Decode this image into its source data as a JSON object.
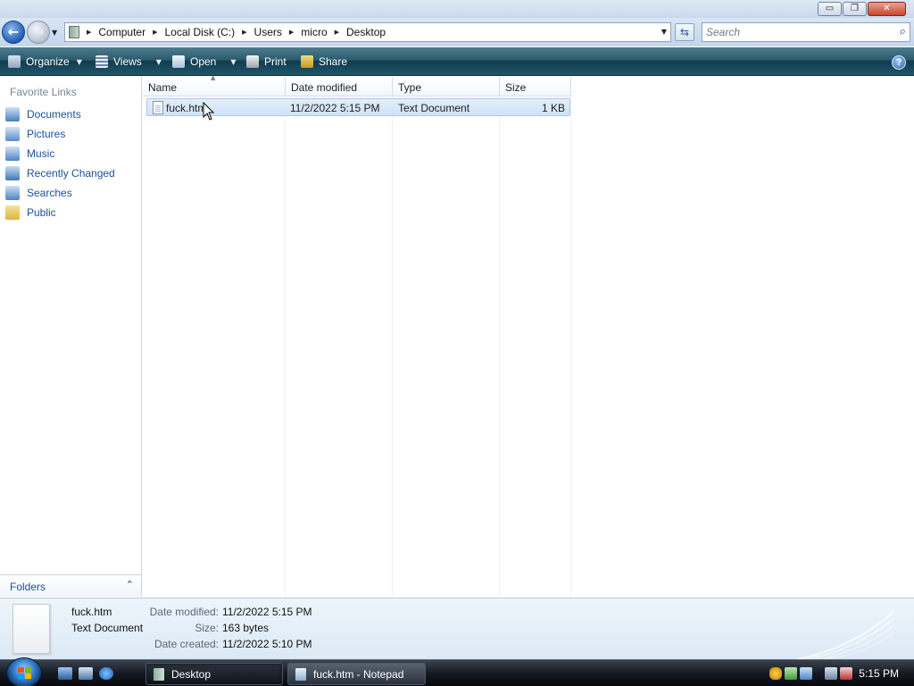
{
  "window": {
    "controls": {
      "minimize": "▭",
      "maximize": "❐",
      "close": "✕"
    }
  },
  "address_bar": {
    "back_glyph": "←",
    "forward_glyph": "→",
    "breadcrumbs": [
      "Computer",
      "Local Disk (C:)",
      "Users",
      "micro",
      "Desktop"
    ],
    "search_placeholder": "Search"
  },
  "command_bar": {
    "items": [
      {
        "label": "Organize",
        "icon": "organize-icon",
        "has_dropdown": true
      },
      {
        "label": "Views",
        "icon": "views-icon",
        "has_dropdown": true
      },
      {
        "label": "Open",
        "icon": "open-icon",
        "has_dropdown": true
      },
      {
        "label": "Print",
        "icon": "printer-icon",
        "has_dropdown": false
      },
      {
        "label": "Share",
        "icon": "share-icon",
        "has_dropdown": false
      }
    ],
    "help_glyph": "?"
  },
  "nav_pane": {
    "heading": "Favorite Links",
    "links": [
      {
        "label": "Documents",
        "icon": "documents-icon",
        "color": "#4a7fc1"
      },
      {
        "label": "Pictures",
        "icon": "pictures-icon",
        "color": "#5a8cc9"
      },
      {
        "label": "Music",
        "icon": "music-icon",
        "color": "#4f84c4"
      },
      {
        "label": "Recently Changed",
        "icon": "recently-changed-icon",
        "color": "#3f78b9"
      },
      {
        "label": "Searches",
        "icon": "searches-icon",
        "color": "#4d83c2"
      },
      {
        "label": "Public",
        "icon": "public-folder-icon",
        "color": "#e0b43a"
      }
    ],
    "folders_label": "Folders"
  },
  "file_list": {
    "columns": [
      "Name",
      "Date modified",
      "Type",
      "Size"
    ],
    "rows": [
      {
        "name": "fuck.htm",
        "date_modified": "11/2/2022 5:15 PM",
        "type": "Text Document",
        "size": "1 KB",
        "selected": true
      }
    ]
  },
  "details_pane": {
    "file_name": "fuck.htm",
    "file_type": "Text Document",
    "fields": [
      {
        "label": "Date modified:",
        "value": "11/2/2022 5:15 PM"
      },
      {
        "label": "Size:",
        "value": "163 bytes"
      },
      {
        "label": "Date created:",
        "value": "11/2/2022 5:10 PM"
      }
    ]
  },
  "taskbar": {
    "tasks": [
      {
        "label": "Desktop",
        "active": true
      },
      {
        "label": "fuck.htm - Notepad",
        "active": false
      }
    ],
    "clock": "5:15 PM"
  },
  "colors": {
    "link": "#1c4f9c",
    "selection": "#cfe2f8",
    "command_bar": "#2b5a6d"
  }
}
